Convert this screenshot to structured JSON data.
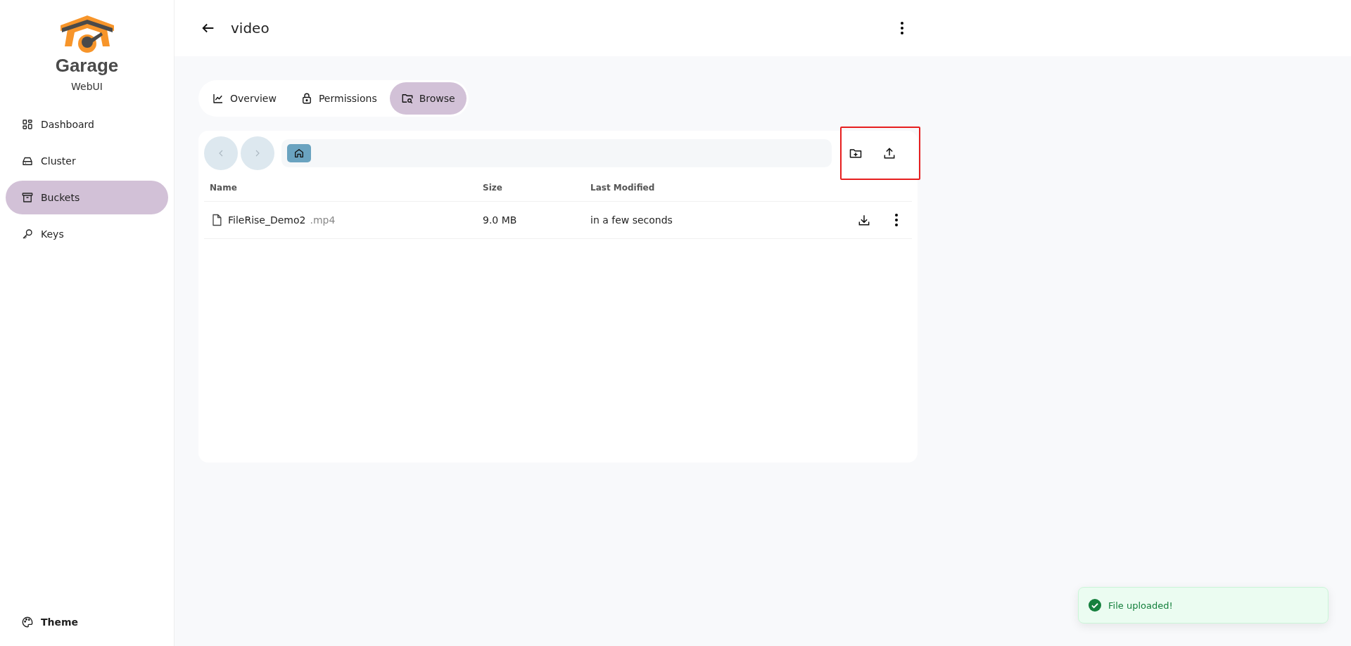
{
  "sidebar": {
    "logo": {
      "title": "Garage",
      "subtitle": "WebUI"
    },
    "items": [
      {
        "label": "Dashboard",
        "selected": false
      },
      {
        "label": "Cluster",
        "selected": false
      },
      {
        "label": "Buckets",
        "selected": true
      },
      {
        "label": "Keys",
        "selected": false
      }
    ],
    "theme": {
      "label": "Theme"
    }
  },
  "header": {
    "title": "video"
  },
  "tabs": [
    {
      "label": "Overview",
      "selected": false
    },
    {
      "label": "Permissions",
      "selected": false
    },
    {
      "label": "Browse",
      "selected": true
    }
  ],
  "browser": {
    "back": {
      "disabled": true
    },
    "forward": {
      "disabled": true
    },
    "columns": [
      "Name",
      "Size",
      "Last Modified"
    ],
    "rows": [
      {
        "name": "FileRise_Demo2",
        "extension": ".mp4",
        "size": "9.0 MB",
        "modified": "in a few seconds"
      }
    ]
  },
  "toast": {
    "message": "File uploaded!"
  }
}
